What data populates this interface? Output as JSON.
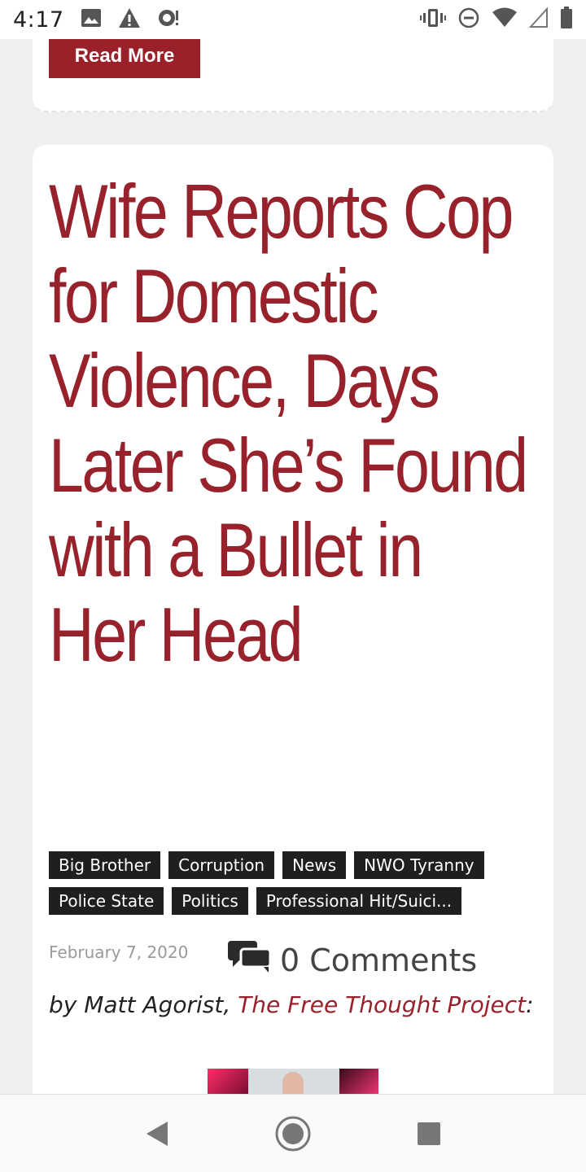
{
  "status_bar": {
    "time": "4:17",
    "icons": [
      "image-icon",
      "warning-icon",
      "chat-alert-icon",
      "vibrate-icon",
      "dnd-icon",
      "wifi-icon",
      "signal-icon",
      "battery-icon"
    ]
  },
  "previous_card": {
    "read_more_label": "Read More"
  },
  "article": {
    "title": "Wife Reports Cop for Domestic Violence, Days Later She’s Found with a Bullet in Her Head",
    "tags": [
      "Big Brother",
      "Corruption",
      "News",
      "NWO Tyranny",
      "Police State",
      "Politics",
      "Professional Hit/Suici..."
    ],
    "date": "February 7, 2020",
    "comments_label": "0 Comments",
    "byline_prefix": "by Matt Agorist,",
    "byline_source": "The Free Thought Project",
    "byline_suffix": ":"
  },
  "nav_bar": {
    "buttons": [
      "back-icon",
      "home-icon",
      "recents-icon"
    ]
  },
  "colors": {
    "accent": "#98222b",
    "tag_bg": "#1f1f1f",
    "page_bg": "#efefef"
  }
}
